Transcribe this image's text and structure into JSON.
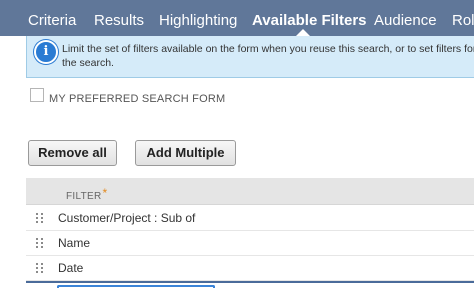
{
  "tabs": [
    {
      "label": "Criteria",
      "active": false
    },
    {
      "label": "Results",
      "active": false
    },
    {
      "label": "Highlighting",
      "active": false
    },
    {
      "label": "Available Filters",
      "active": true
    },
    {
      "label": "Audience",
      "active": false
    },
    {
      "label": "Roles",
      "active": false
    }
  ],
  "banner": {
    "icon": "info-icon",
    "text": "Limit the set of filters available on the form when you reuse this search, or to set filters for the search."
  },
  "preferred_form": {
    "label": "MY PREFERRED SEARCH FORM",
    "checked": false
  },
  "buttons": {
    "remove_all": "Remove all",
    "add_multiple": "Add Multiple"
  },
  "table": {
    "header": "FILTER",
    "required_marker": "*",
    "rows": [
      {
        "filter": "Customer/Project : Sub of"
      },
      {
        "filter": "Name"
      },
      {
        "filter": "Date"
      }
    ],
    "new_row_value": ""
  },
  "colors": {
    "tabbar": "#607799",
    "banner_bg": "#d5ebf9",
    "info_icon": "#2a7bd3",
    "required": "#e38a1e"
  }
}
